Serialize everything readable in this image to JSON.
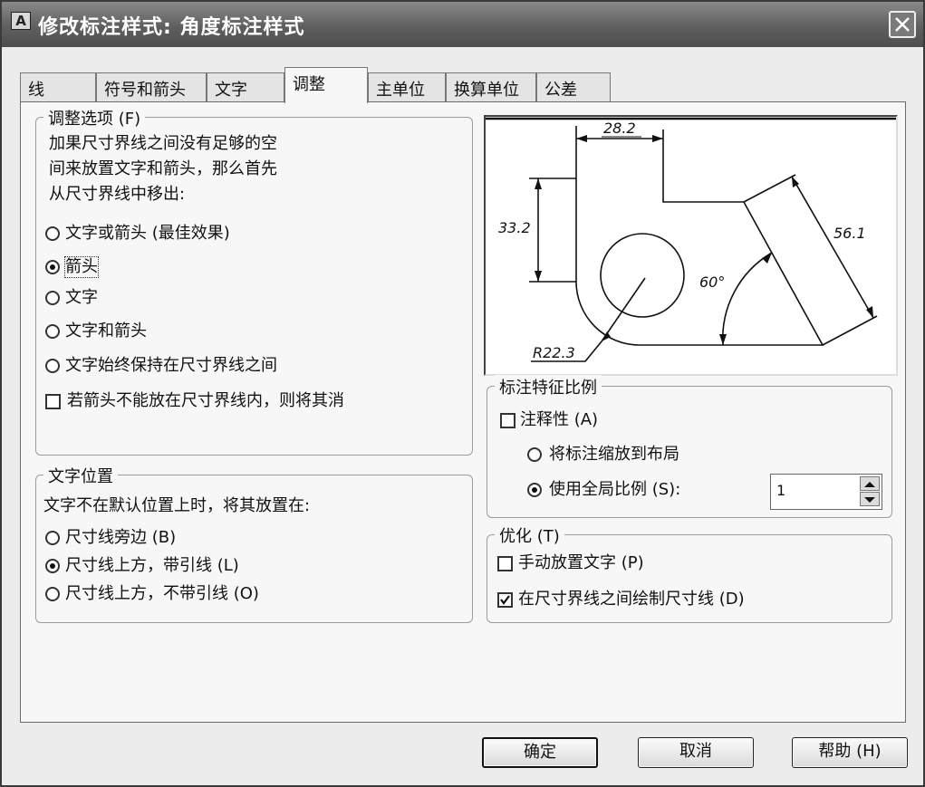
{
  "window": {
    "title": "修改标注样式:  角度标注样式",
    "app_icon": "A"
  },
  "tabs": [
    {
      "label": "线"
    },
    {
      "label": "符号和箭头"
    },
    {
      "label": "文字"
    },
    {
      "label": "调整"
    },
    {
      "label": "主单位"
    },
    {
      "label": "换算单位"
    },
    {
      "label": "公差"
    }
  ],
  "active_tab": "调整",
  "fit_options": {
    "title": "调整选项 (F)",
    "desc": [
      "加果尺寸界线之间没有足够的空",
      "间来放置文字和箭头，那么首先",
      "从尺寸界线中移出:"
    ],
    "radios": [
      {
        "label": "文字或箭头 (最佳效果)",
        "selected": false
      },
      {
        "label": "箭头",
        "selected": true
      },
      {
        "label": "文字",
        "selected": false
      },
      {
        "label": "文字和箭头",
        "selected": false
      },
      {
        "label": "文字始终保持在尺寸界线之间",
        "selected": false
      }
    ],
    "suppress_check": {
      "label": "若箭头不能放在尺寸界线内，则将其消",
      "checked": false
    }
  },
  "text_placement": {
    "title": "文字位置",
    "desc": "文字不在默认位置上时，将其放置在:",
    "radios": [
      {
        "label": "尺寸线旁边 (B)",
        "selected": false
      },
      {
        "label": "尺寸线上方，带引线 (L)",
        "selected": true
      },
      {
        "label": "尺寸线上方，不带引线 (O)",
        "selected": false
      }
    ]
  },
  "preview": {
    "labels": [
      "28.2",
      "33.2",
      "56.1",
      "60°",
      "R22.3"
    ]
  },
  "scale": {
    "title": "标注特征比例",
    "annotative": {
      "label": "注释性 (A)",
      "checked": false
    },
    "radios": [
      {
        "label": "将标注缩放到布局",
        "selected": false
      },
      {
        "label": "使用全局比例 (S):",
        "selected": true
      }
    ],
    "value": "1"
  },
  "fine_tuning": {
    "title": "优化 (T)",
    "manual": {
      "label": "手动放置文字 (P)",
      "checked": false
    },
    "draw_dim": {
      "label": "在尺寸界线之间绘制尺寸线 (D)",
      "checked": true
    }
  },
  "buttons": {
    "ok": "确定",
    "cancel": "取消",
    "help": "帮助 (H)"
  }
}
